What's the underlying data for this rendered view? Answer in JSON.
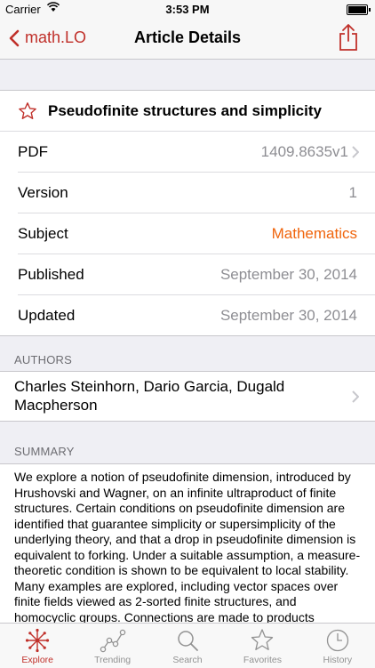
{
  "status_bar": {
    "carrier": "Carrier",
    "time": "3:53 PM"
  },
  "nav": {
    "back_label": "math.LO",
    "title": "Article Details"
  },
  "article": {
    "title": "Pseudofinite structures and simplicity",
    "rows": [
      {
        "label": "PDF",
        "value": "1409.8635v1"
      },
      {
        "label": "Version",
        "value": "1"
      },
      {
        "label": "Subject",
        "value": "Mathematics"
      },
      {
        "label": "Published",
        "value": "September 30, 2014"
      },
      {
        "label": "Updated",
        "value": "September 30, 2014"
      }
    ]
  },
  "authors": {
    "header": "AUTHORS",
    "text": "Charles Steinhorn, Dario Garcia, Dugald Macpherson"
  },
  "summary": {
    "header": "SUMMARY",
    "text": "We explore a notion of pseudofinite dimension, introduced by Hrushovski and Wagner, on an infinite ultraproduct of finite structures. Certain conditions on pseudofinite dimension are identified that guarantee simplicity or supersimplicity of the underlying theory, and that a drop in pseudofinite dimension is equivalent to forking. Under a suitable assumption, a measure-theoretic condition is shown to be equivalent to local stability. Many examples are explored, including vector spaces over finite fields viewed as 2-sorted finite structures, and homocyclic groups. Connections are made to products"
  },
  "tabs": [
    {
      "label": "Explore",
      "icon": "explore-icon"
    },
    {
      "label": "Trending",
      "icon": "trending-icon"
    },
    {
      "label": "Search",
      "icon": "search-icon"
    },
    {
      "label": "Favorites",
      "icon": "star-icon"
    },
    {
      "label": "History",
      "icon": "clock-icon"
    }
  ],
  "colors": {
    "accent": "#c0302a",
    "subject": "#f0650d",
    "secondary_text": "#8e8e93",
    "background": "#efeff4"
  }
}
